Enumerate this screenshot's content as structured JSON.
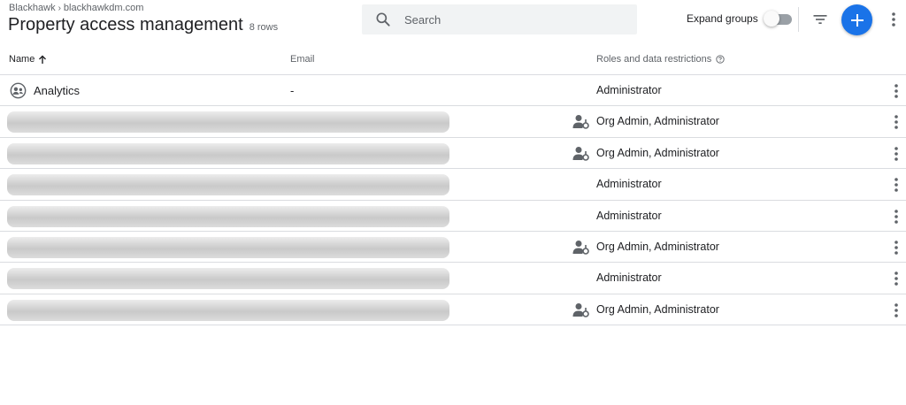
{
  "breadcrumb": {
    "account": "Blackhawk",
    "separator": "›",
    "property": "blackhawkdm.com"
  },
  "page": {
    "title": "Property access management",
    "row_count": "8 rows"
  },
  "search": {
    "placeholder": "Search"
  },
  "toolbar": {
    "expand_groups_label": "Expand groups",
    "expand_groups_on": false
  },
  "table": {
    "columns": {
      "name": "Name",
      "email": "Email",
      "roles": "Roles and data restrictions"
    },
    "sort": {
      "column": "Name",
      "direction": "ascending"
    },
    "rows": [
      {
        "name": "Analytics",
        "email": "-",
        "roles": "Administrator",
        "redacted": false,
        "icon": "group-icon",
        "admin_badge": false
      },
      {
        "name": "",
        "email": "",
        "roles": "Org Admin, Administrator",
        "redacted": true,
        "admin_badge": true
      },
      {
        "name": "",
        "email": "",
        "roles": "Org Admin, Administrator",
        "redacted": true,
        "admin_badge": true
      },
      {
        "name": "",
        "email": "",
        "roles": "Administrator",
        "redacted": true,
        "admin_badge": false
      },
      {
        "name": "",
        "email": "",
        "roles": "Administrator",
        "redacted": true,
        "admin_badge": false
      },
      {
        "name": "",
        "email": "",
        "roles": "Org Admin, Administrator",
        "redacted": true,
        "admin_badge": true
      },
      {
        "name": "",
        "email": "",
        "roles": "Administrator",
        "redacted": true,
        "admin_badge": false
      },
      {
        "name": "",
        "email": "",
        "roles": "Org Admin, Administrator",
        "redacted": true,
        "admin_badge": true
      }
    ]
  },
  "colors": {
    "accent": "#1a73e8",
    "divider": "#dadce0",
    "text": "#202124",
    "muted": "#5f6368",
    "search_bg": "#f1f3f4"
  },
  "icons": {
    "search": "search-icon",
    "filter": "filter-icon",
    "add": "plus-icon",
    "more": "more-vert-icon",
    "help": "help-icon",
    "sort": "arrow-up-icon",
    "admin": "person-admin-icon",
    "group": "group-icon"
  }
}
